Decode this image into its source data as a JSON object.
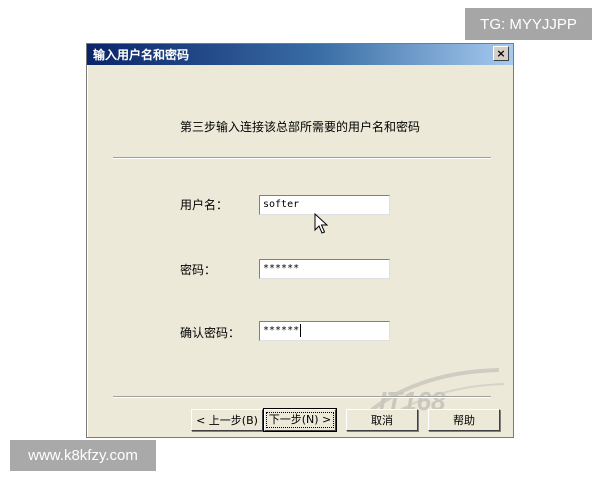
{
  "overlay": {
    "top_right_badge": "TG: MYYJJPP",
    "bottom_left_badge": "www.k8kfzy.com",
    "watermark_text": "IT168"
  },
  "dialog": {
    "title": "输入用户名和密码",
    "close_label": "×",
    "step_text": "第三步输入连接该总部所需要的用户名和密码",
    "fields": {
      "username": {
        "label": "用户名：",
        "value": "softer"
      },
      "password": {
        "label": "密码：",
        "value": "******"
      },
      "confirm": {
        "label": "确认密码：",
        "value": "******"
      }
    },
    "buttons": {
      "back": "< 上一步(B)",
      "next": "下一步(N) >",
      "cancel": "取消",
      "help": "帮助"
    }
  },
  "colors": {
    "dialog_bg": "#ece9d8",
    "titlebar_start": "#0a246a",
    "titlebar_end": "#a6caf0"
  }
}
